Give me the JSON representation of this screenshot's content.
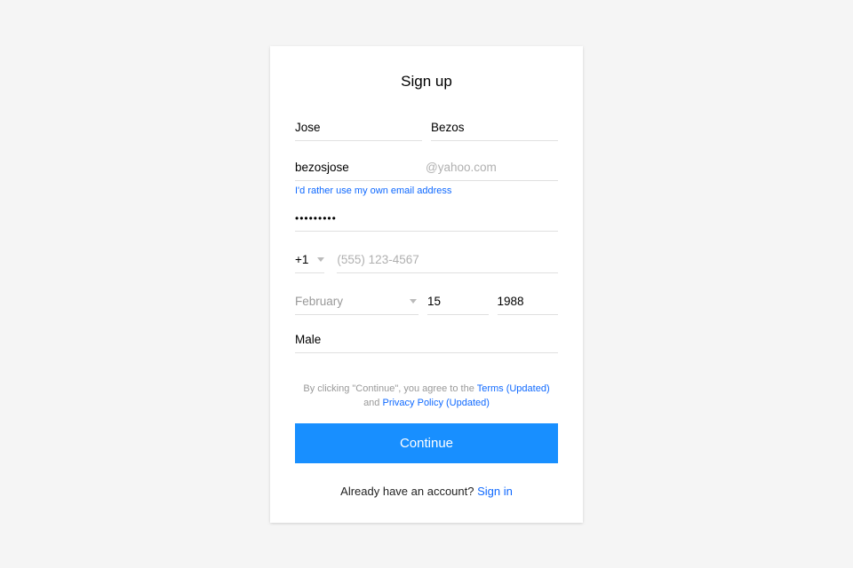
{
  "title": "Sign up",
  "name": {
    "first": "Jose",
    "last": "Bezos"
  },
  "email": {
    "local": "bezosjose",
    "suffix": "@yahoo.com"
  },
  "own_email_link": "I'd rather use my own email address",
  "password": "•••••••••",
  "phone": {
    "code": "+1",
    "placeholder": "(555) 123-4567"
  },
  "dob": {
    "month": "February",
    "day": "15",
    "year": "1988"
  },
  "gender": "Male",
  "terms": {
    "prefix": "By clicking \"Continue\", you agree to the ",
    "link1": "Terms (Updated)",
    "mid": " and ",
    "link2": "Privacy Policy (Updated)"
  },
  "continue_label": "Continue",
  "signin": {
    "text": "Already have an account? ",
    "link": "Sign in"
  }
}
